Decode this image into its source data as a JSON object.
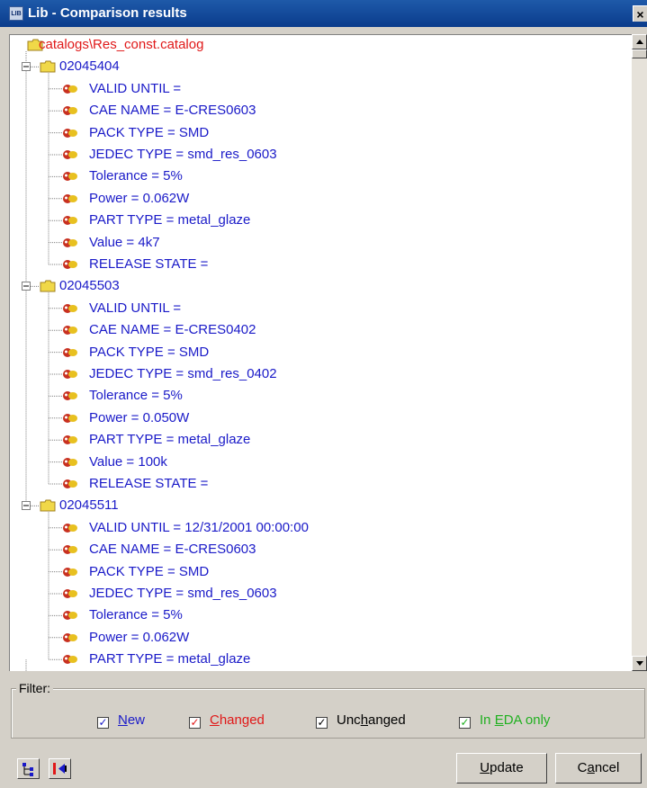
{
  "window": {
    "title": "Lib - Comparison results",
    "icon_text": "LIB",
    "close_label": "×"
  },
  "tree": {
    "root": "catalogs\\Res_const.catalog",
    "nodes": [
      {
        "label": "02045404",
        "children": [
          "VALID UNTIL =",
          "CAE NAME = E-CRES0603",
          "PACK TYPE = SMD",
          "JEDEC TYPE = smd_res_0603",
          "Tolerance = 5%",
          "Power = 0.062W",
          "PART TYPE = metal_glaze",
          "Value = 4k7",
          "RELEASE STATE ="
        ]
      },
      {
        "label": "02045503",
        "children": [
          "VALID UNTIL =",
          "CAE NAME = E-CRES0402",
          "PACK TYPE = SMD",
          "JEDEC TYPE = smd_res_0402",
          "Tolerance = 5%",
          "Power = 0.050W",
          "PART TYPE = metal_glaze",
          "Value = 100k",
          "RELEASE STATE ="
        ]
      },
      {
        "label": "02045511",
        "children": [
          "VALID UNTIL = 12/31/2001 00:00:00",
          "CAE NAME = E-CRES0603",
          "PACK TYPE = SMD",
          "JEDEC TYPE = smd_res_0603",
          "Tolerance = 5%",
          "Power = 0.062W",
          "PART TYPE = metal_glaze"
        ]
      }
    ]
  },
  "filter": {
    "label": "Filter:",
    "checkboxes": [
      {
        "key": "new",
        "pre": "",
        "u": "N",
        "post": "ew",
        "checked": true,
        "color": "#1a1ac8"
      },
      {
        "key": "changed",
        "pre": "",
        "u": "C",
        "post": "hanged",
        "checked": true,
        "color": "#e01818"
      },
      {
        "key": "unchanged",
        "pre": "Unc",
        "u": "h",
        "post": "anged",
        "checked": true,
        "color": "#000000"
      },
      {
        "key": "edaonly",
        "pre": "In ",
        "u": "E",
        "post": "DA only",
        "checked": true,
        "color": "#20b020"
      }
    ]
  },
  "buttons": {
    "update": {
      "u": "U",
      "rest": "pdate"
    },
    "cancel": {
      "pre": "C",
      "u": "a",
      "post": "ncel"
    }
  },
  "colors": {
    "root_text": "#e01818",
    "node_text": "#1a1ac8",
    "folder": "#f0d848",
    "leaf_icon_red": "#c83020",
    "leaf_icon_yellow": "#e8c020"
  }
}
